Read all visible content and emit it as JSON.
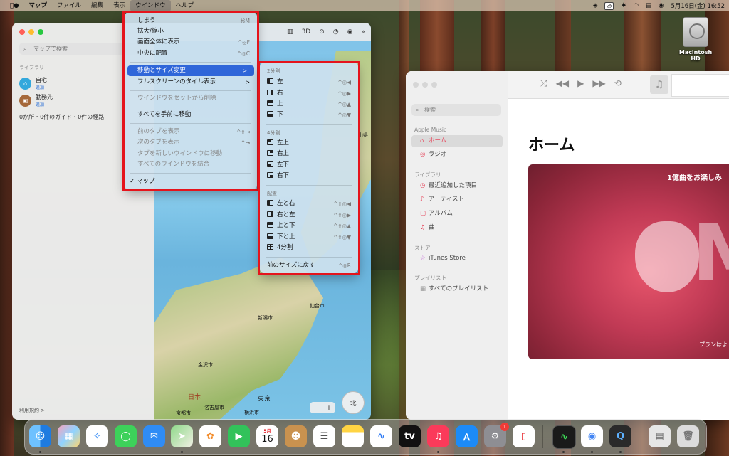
{
  "menubar": {
    "apple": "",
    "items": [
      "マップ",
      "ファイル",
      "編集",
      "表示",
      "ウインドウ",
      "ヘルプ"
    ],
    "ime": "あ",
    "clock": "5月16日(金)  16:52"
  },
  "desktop": {
    "disk_label": "Macintosh HD"
  },
  "maps": {
    "search_placeholder": "マップで検索",
    "library_label": "ライブラリ",
    "home": {
      "title": "自宅",
      "action": "追加"
    },
    "work": {
      "title": "勤務先",
      "action": "追加"
    },
    "counts": "0か所・0件のガイド・0件の経路",
    "terms": "利用規約 >",
    "toolbar_3d": "3D",
    "cities": [
      "仙台市",
      "新潟市",
      "金沢市",
      "日本",
      "東京",
      "名古屋市",
      "京都市",
      "横浜市",
      "山県"
    ],
    "zoom_minus": "−",
    "zoom_plus": "+",
    "compass": "北"
  },
  "window_menu": {
    "items": [
      {
        "label": "しまう",
        "shortcut": "⌘M",
        "disabled": false
      },
      {
        "label": "拡大/縮小",
        "shortcut": "",
        "disabled": false
      },
      {
        "label": "画面全体に表示",
        "shortcut": "^◎F",
        "disabled": false
      },
      {
        "label": "中央に配置",
        "shortcut": "^◎C",
        "disabled": false
      },
      {
        "label": "移動とサイズ変更",
        "shortcut": ">",
        "disabled": false,
        "highlighted": true
      },
      {
        "label": "フルスクリーンのタイル表示",
        "shortcut": ">",
        "disabled": false
      },
      {
        "label": "ウインドウをセットから削除",
        "shortcut": "",
        "disabled": true
      },
      {
        "label": "すべてを手前に移動",
        "shortcut": "",
        "disabled": false
      },
      {
        "label": "前のタブを表示",
        "shortcut": "^⇧⇥",
        "disabled": true
      },
      {
        "label": "次のタブを表示",
        "shortcut": "^⇥",
        "disabled": true
      },
      {
        "label": "タブを新しいウインドウに移動",
        "shortcut": "",
        "disabled": true
      },
      {
        "label": "すべてのウインドウを結合",
        "shortcut": "",
        "disabled": true
      },
      {
        "label": "✓ マップ",
        "shortcut": "",
        "disabled": false
      }
    ]
  },
  "submenu": {
    "sections": [
      {
        "title": "2分割",
        "items": [
          {
            "label": "左",
            "shortcut": "^◎◀"
          },
          {
            "label": "右",
            "shortcut": "^◎▶"
          },
          {
            "label": "上",
            "shortcut": "^◎▲"
          },
          {
            "label": "下",
            "shortcut": "^◎▼"
          }
        ]
      },
      {
        "title": "4分割",
        "items": [
          {
            "label": "左上",
            "shortcut": ""
          },
          {
            "label": "右上",
            "shortcut": ""
          },
          {
            "label": "左下",
            "shortcut": ""
          },
          {
            "label": "右下",
            "shortcut": ""
          }
        ]
      },
      {
        "title": "配置",
        "items": [
          {
            "label": "左と右",
            "shortcut": "^⇧◎◀"
          },
          {
            "label": "右と左",
            "shortcut": "^⇧◎▶"
          },
          {
            "label": "上と下",
            "shortcut": "^⇧◎▲"
          },
          {
            "label": "下と上",
            "shortcut": "^⇧◎▼"
          },
          {
            "label": "4分割",
            "shortcut": ""
          }
        ]
      }
    ],
    "return": {
      "label": "前のサイズに戻す",
      "shortcut": "^◎R"
    }
  },
  "music": {
    "search_placeholder": "検索",
    "apple_music_label": "Apple Music",
    "home": "ホーム",
    "radio": "ラジオ",
    "library_label": "ライブラリ",
    "recent": "最近追加した項目",
    "artists": "アーティスト",
    "albums": "アルバム",
    "songs": "曲",
    "store_label": "ストア",
    "itunes": "iTunes Store",
    "playlist_label": "プレイリスト",
    "all_playlists": "すべてのプレイリスト",
    "page_title": "ホーム",
    "banner_title": "1億曲をお楽しみ",
    "banner_sub": "プランはよ",
    "banner_letter": "M"
  },
  "dock": {
    "calendar_month": "5月",
    "calendar_day": "16",
    "settings_badge": "1"
  }
}
